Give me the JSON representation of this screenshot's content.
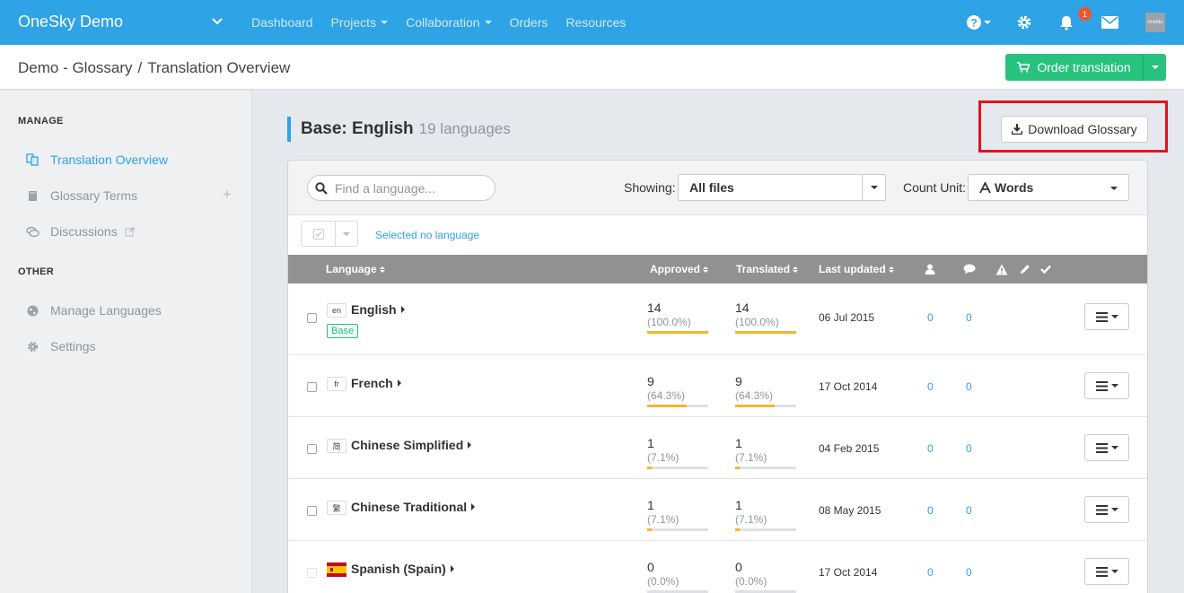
{
  "nav": {
    "brand": "OneSky Demo",
    "links": [
      {
        "label": "Dashboard",
        "caret": false
      },
      {
        "label": "Projects",
        "caret": true
      },
      {
        "label": "Collaboration",
        "caret": true
      },
      {
        "label": "Orders",
        "caret": false
      },
      {
        "label": "Resources",
        "caret": false
      }
    ],
    "notification_count": "1",
    "avatar_text": "OneSky",
    "colors": {
      "bar": "#2ea3e5",
      "badge": "#f0542d"
    }
  },
  "header": {
    "breadcrumb_root": "Demo - Glossary",
    "breadcrumb_sep": "/",
    "breadcrumb_current": "Translation Overview",
    "order_button": "Order translation"
  },
  "sidebar": {
    "manage_heading": "MANAGE",
    "other_heading": "OTHER",
    "items": [
      {
        "label": "Translation Overview",
        "icon": "translate-icon",
        "active": true
      },
      {
        "label": "Glossary Terms",
        "icon": "book-icon",
        "active": false
      },
      {
        "label": "Discussions",
        "icon": "chat-icon",
        "active": false
      },
      {
        "label": "Manage Languages",
        "icon": "globe-icon",
        "active": false
      },
      {
        "label": "Settings",
        "icon": "gear-icon",
        "active": false
      }
    ]
  },
  "main": {
    "title": "Base: English",
    "language_count": "19 languages",
    "download_button": "Download Glossary",
    "search_placeholder": "Find a language...",
    "showing_label": "Showing:",
    "showing_value": "All files",
    "count_unit_label": "Count Unit:",
    "count_unit_value": "Words",
    "selected_text": "Selected no language",
    "columns": {
      "language": "Language",
      "approved": "Approved",
      "translated": "Translated",
      "last_updated": "Last updated"
    },
    "base_badge": "Base",
    "rows": [
      {
        "code": "en",
        "name": "English",
        "approved": "14",
        "approved_pct": "(100.0%)",
        "approved_frac": 1.0,
        "translated": "14",
        "translated_pct": "(100.0%)",
        "translated_frac": 1.0,
        "date": "06 Jul 2015",
        "users": "0",
        "comments": "0",
        "base": true
      },
      {
        "code": "fr",
        "name": "French",
        "approved": "9",
        "approved_pct": "(64.3%)",
        "approved_frac": 0.643,
        "translated": "9",
        "translated_pct": "(64.3%)",
        "translated_frac": 0.643,
        "date": "17 Oct 2014",
        "users": "0",
        "comments": "0",
        "base": false
      },
      {
        "code": "简",
        "name": "Chinese Simplified",
        "approved": "1",
        "approved_pct": "(7.1%)",
        "approved_frac": 0.071,
        "translated": "1",
        "translated_pct": "(7.1%)",
        "translated_frac": 0.071,
        "date": "04 Feb 2015",
        "users": "0",
        "comments": "0",
        "base": false
      },
      {
        "code": "繁",
        "name": "Chinese Traditional",
        "approved": "1",
        "approved_pct": "(7.1%)",
        "approved_frac": 0.071,
        "translated": "1",
        "translated_pct": "(7.1%)",
        "translated_frac": 0.071,
        "date": "08 May 2015",
        "users": "0",
        "comments": "0",
        "base": false
      },
      {
        "code": "es-flag",
        "name": "Spanish (Spain)",
        "approved": "0",
        "approved_pct": "(0.0%)",
        "approved_frac": 0.0,
        "translated": "0",
        "translated_pct": "(0.0%)",
        "translated_frac": 0.0,
        "date": "17 Oct 2014",
        "users": "0",
        "comments": "0",
        "base": false
      }
    ]
  }
}
